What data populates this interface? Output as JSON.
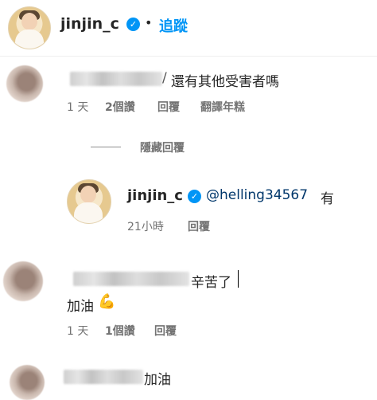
{
  "header": {
    "username": "jinjin_c",
    "dot": "•",
    "follow": "追蹤"
  },
  "comment1": {
    "text": "還有其他受害者嗎",
    "time": "1 天",
    "likes": "2個讚",
    "reply": "回覆",
    "translate": "翻譯年糕"
  },
  "hide_replies": "隱藏回覆",
  "reply1": {
    "username": "jinjin_c",
    "mention": "@helling34567",
    "text": "有",
    "time": "21小時",
    "reply": "回覆"
  },
  "comment2": {
    "text_line1": "辛苦了",
    "text_line2": "加油",
    "emoji": "💪",
    "time": "1 天",
    "likes": "1個讚",
    "reply": "回覆"
  },
  "comment3": {
    "text": "加油"
  },
  "colors": {
    "verified": "#0095f6",
    "follow": "#0095f6",
    "mention": "#00376b",
    "meta": "#737373"
  }
}
